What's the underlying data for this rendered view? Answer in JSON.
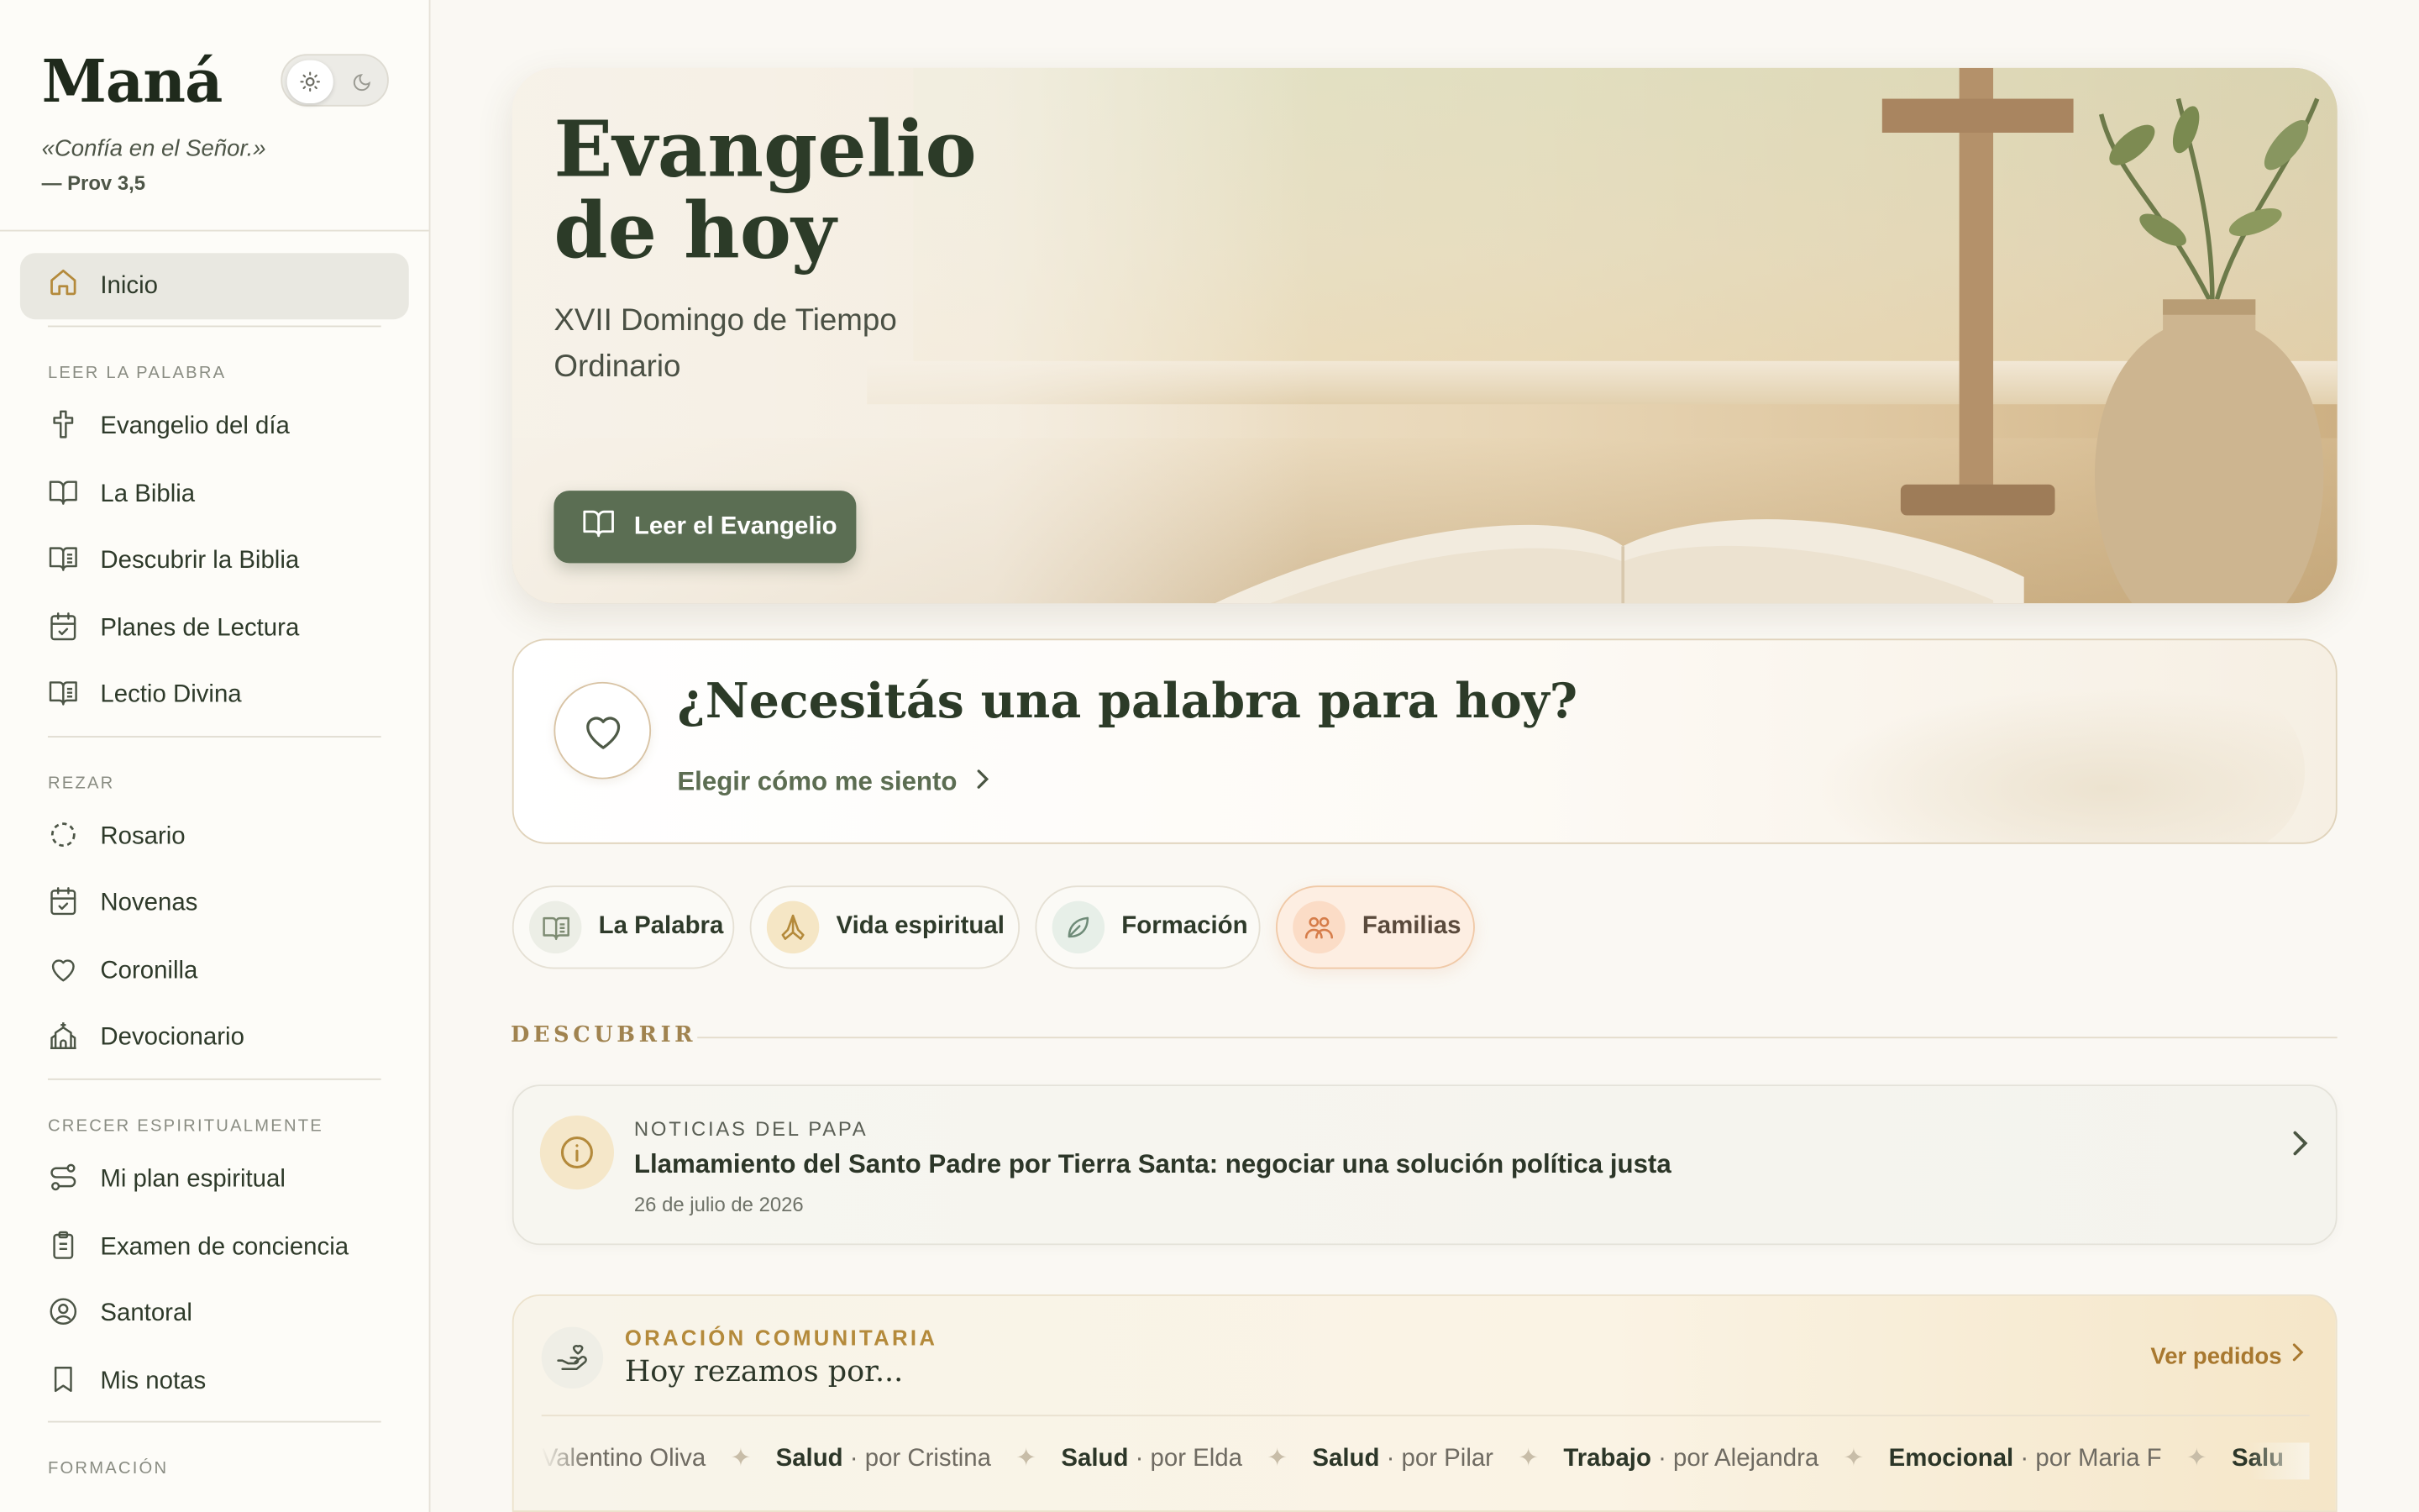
{
  "brand": {
    "name": "Maná",
    "quote": "«Confía en el Señor.»",
    "quote_ref": "— Prov 3,5"
  },
  "theme_toggle": {
    "mode": "light",
    "light_icon": "sun-icon",
    "dark_icon": "moon-icon"
  },
  "sidebar": {
    "home": {
      "label": "Inicio",
      "icon": "home-icon"
    },
    "sections": [
      {
        "title": "LEER LA PALABRA",
        "items": [
          {
            "label": "Evangelio del día",
            "icon": "cross-icon"
          },
          {
            "label": "La Biblia",
            "icon": "book-open-icon"
          },
          {
            "label": "Descubrir la Biblia",
            "icon": "book-text-icon"
          },
          {
            "label": "Planes de Lectura",
            "icon": "calendar-check-icon"
          },
          {
            "label": "Lectio Divina",
            "icon": "book-text-icon"
          }
        ]
      },
      {
        "title": "REZAR",
        "items": [
          {
            "label": "Rosario",
            "icon": "dashed-circle-icon"
          },
          {
            "label": "Novenas",
            "icon": "calendar-check-icon"
          },
          {
            "label": "Coronilla",
            "icon": "heart-icon"
          },
          {
            "label": "Devocionario",
            "icon": "church-icon"
          }
        ]
      },
      {
        "title": "CRECER ESPIRITUALMENTE",
        "items": [
          {
            "label": "Mi plan espiritual",
            "icon": "route-icon"
          },
          {
            "label": "Examen de conciencia",
            "icon": "clipboard-icon"
          },
          {
            "label": "Santoral",
            "icon": "user-circle-icon"
          },
          {
            "label": "Mis notas",
            "icon": "bookmark-icon"
          }
        ]
      },
      {
        "title": "FORMACIÓN",
        "items": []
      }
    ]
  },
  "hero": {
    "title": "Evangelio de hoy",
    "subtitle": "XVII Domingo de Tiempo Ordinario",
    "button_label": "Leer el Evangelio",
    "button_icon": "book-open-icon"
  },
  "word_card": {
    "title": "¿Necesitás una palabra para hoy?",
    "link_label": "Elegir cómo me siento",
    "icon": "heart-icon"
  },
  "chips": [
    {
      "label": "La Palabra",
      "icon": "book-text-icon",
      "active": false,
      "icon_bg": "#eceee6",
      "icon_color": "#7d8b72"
    },
    {
      "label": "Vida espiritual",
      "icon": "praying-hands-icon",
      "active": false,
      "icon_bg": "#f5e6c5",
      "icon_color": "#b48a3b"
    },
    {
      "label": "Formación",
      "icon": "leaf-icon",
      "active": false,
      "icon_bg": "#e7efe8",
      "icon_color": "#6f8b78"
    },
    {
      "label": "Familias",
      "icon": "family-icon",
      "active": true,
      "icon_bg": "#fbdcc6",
      "icon_color": "#d67d4a"
    }
  ],
  "discover": {
    "heading": "DESCUBRIR"
  },
  "news": {
    "kicker": "NOTICIAS DEL PAPA",
    "title": "Llamamiento del Santo Padre por Tierra Santa: negociar una solución política justa",
    "date": "26 de julio de 2026",
    "icon": "info-icon"
  },
  "prayer": {
    "kicker": "ORACIÓN COMUNITARIA",
    "title": "Hoy rezamos por...",
    "link_label": "Ver pedidos",
    "icon": "hand-heart-icon",
    "requests": [
      {
        "category": "",
        "by": "Valentino Oliva"
      },
      {
        "category": "Salud",
        "by": "· por Cristina"
      },
      {
        "category": "Salud",
        "by": "· por Elda"
      },
      {
        "category": "Salud",
        "by": "· por Pilar"
      },
      {
        "category": "Trabajo",
        "by": "· por Alejandra"
      },
      {
        "category": "Emocional",
        "by": "· por Maria F"
      },
      {
        "category": "Salu",
        "by": ""
      }
    ]
  },
  "colors": {
    "accent_green": "#5b6e53",
    "gold": "#b48a3b",
    "background": "#faf8f3"
  }
}
